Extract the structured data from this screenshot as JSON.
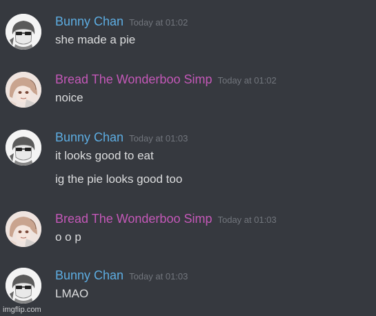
{
  "colors": {
    "background": "#36393f",
    "bunny_name": "#5dade2",
    "bread_name": "#c458b8",
    "timestamp": "#72767d",
    "message_text": "#dcddde"
  },
  "messages": [
    {
      "username": "Bunny Chan",
      "timestamp": "Today at 01:02",
      "avatar_icon": "sunglasses-anime-boy-avatar",
      "lines": [
        "she made a pie"
      ]
    },
    {
      "username": "Bread The Wonderboo Simp",
      "timestamp": "Today at 01:02",
      "avatar_icon": "anime-girl-avatar",
      "lines": [
        "noice"
      ]
    },
    {
      "username": "Bunny Chan",
      "timestamp": "Today at 01:03",
      "avatar_icon": "sunglasses-anime-boy-avatar",
      "lines": [
        "it looks good to eat",
        "ig the pie looks good too"
      ]
    },
    {
      "username": "Bread The Wonderboo Simp",
      "timestamp": "Today at 01:03",
      "avatar_icon": "anime-girl-avatar",
      "lines": [
        "o o p"
      ]
    },
    {
      "username": "Bunny Chan",
      "timestamp": "Today at 01:03",
      "avatar_icon": "sunglasses-anime-boy-avatar",
      "lines": [
        "LMAO"
      ]
    }
  ],
  "watermark": "imgflip.com"
}
